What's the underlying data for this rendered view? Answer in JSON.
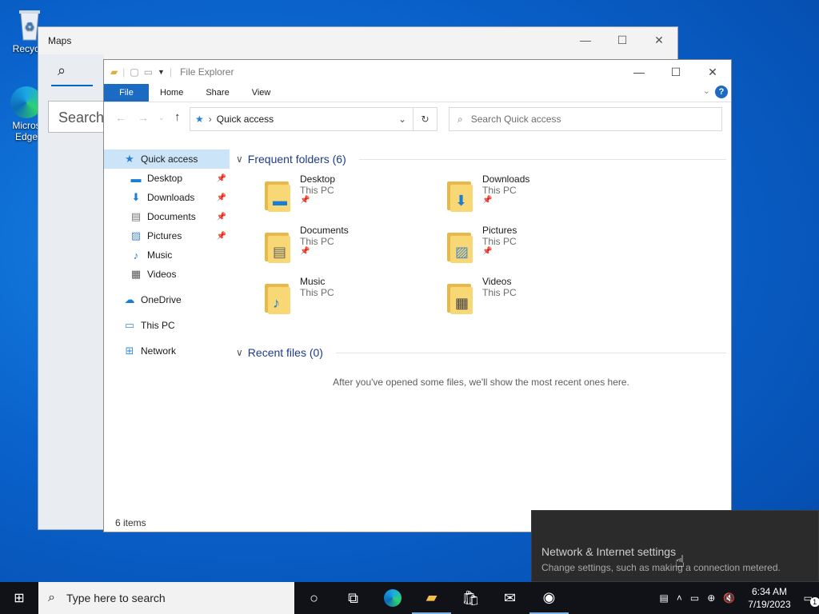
{
  "desktop": {
    "recycle_label": "Recycle",
    "edge_label_1": "Micros",
    "edge_label_2": "Edge"
  },
  "maps": {
    "title": "Maps",
    "search_placeholder": "Search"
  },
  "explorer": {
    "title": "File Explorer",
    "ribbon_tabs": [
      "File",
      "Home",
      "Share",
      "View"
    ],
    "address": "Quick access",
    "search_placeholder": "Search Quick access",
    "nav": {
      "quick_access": "Quick access",
      "desktop": "Desktop",
      "downloads": "Downloads",
      "documents": "Documents",
      "pictures": "Pictures",
      "music": "Music",
      "videos": "Videos",
      "onedrive": "OneDrive",
      "this_pc": "This PC",
      "network": "Network"
    },
    "frequent_header": "Frequent folders (6)",
    "folders": [
      {
        "name": "Desktop",
        "location": "This PC",
        "pinned": true,
        "icon": "desktop-icon"
      },
      {
        "name": "Downloads",
        "location": "This PC",
        "pinned": true,
        "icon": "download-arrow-icon"
      },
      {
        "name": "Documents",
        "location": "This PC",
        "pinned": true,
        "icon": "document-icon"
      },
      {
        "name": "Pictures",
        "location": "This PC",
        "pinned": true,
        "icon": "picture-icon"
      },
      {
        "name": "Music",
        "location": "This PC",
        "pinned": false,
        "icon": "music-note-icon"
      },
      {
        "name": "Videos",
        "location": "This PC",
        "pinned": false,
        "icon": "film-icon"
      }
    ],
    "recent_header": "Recent files (0)",
    "recent_empty": "After you've opened some files, we'll show the most recent ones here.",
    "status": "6 items"
  },
  "toast": {
    "title": "Network & Internet settings",
    "body": "Change settings, such as making a connection metered."
  },
  "taskbar": {
    "search_placeholder": "Type here to search",
    "time": "6:34 AM",
    "date": "7/19/2023",
    "notification_count": "1"
  }
}
